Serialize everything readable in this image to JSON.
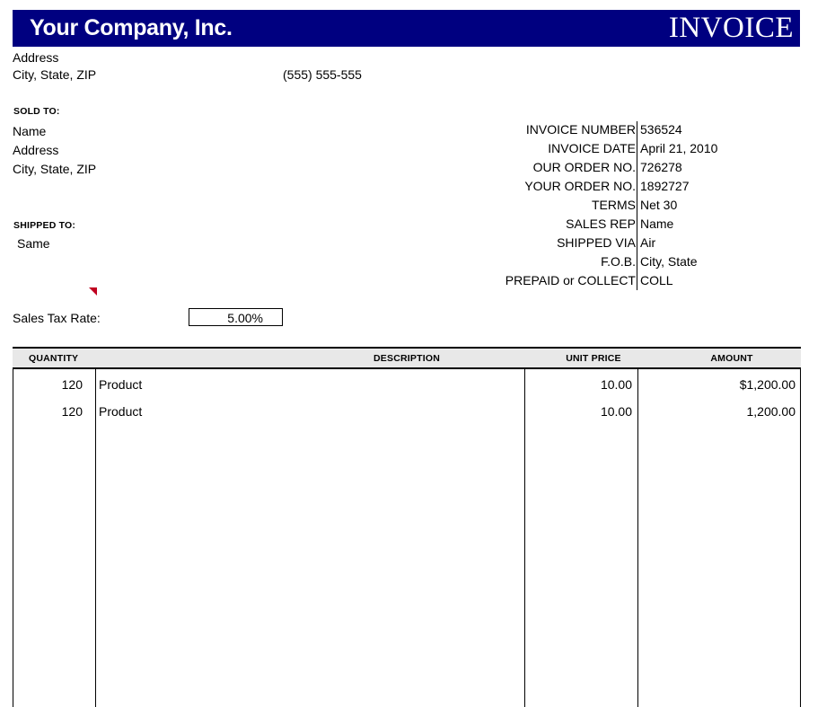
{
  "header": {
    "company_name": "Your Company, Inc.",
    "document_type": "INVOICE",
    "band_color": "#000080",
    "text_color": "#FFFFFF"
  },
  "company": {
    "address_line1": "Address",
    "address_line2": "City, State, ZIP",
    "phone": "(555) 555-555"
  },
  "sold_to": {
    "heading": "SOLD TO:",
    "line1": "Name",
    "line2": "Address",
    "line3": "City, State, ZIP"
  },
  "shipped_to": {
    "heading": "SHIPPED TO:",
    "line1": "Same"
  },
  "tax": {
    "label": "Sales Tax Rate:",
    "value": "5.00%"
  },
  "comment_marker": {
    "color": "#C00020"
  },
  "details": [
    {
      "label": "INVOICE NUMBER",
      "value": "536524"
    },
    {
      "label": "INVOICE DATE",
      "value": "April 21, 2010"
    },
    {
      "label": "OUR ORDER NO.",
      "value": "726278"
    },
    {
      "label": "YOUR ORDER NO.",
      "value": "1892727"
    },
    {
      "label": "TERMS",
      "value": "Net 30"
    },
    {
      "label": "SALES REP",
      "value": "Name"
    },
    {
      "label": "SHIPPED VIA",
      "value": "Air"
    },
    {
      "label": "F.O.B.",
      "value": "City, State"
    },
    {
      "label": "PREPAID or COLLECT",
      "value": "COLL"
    }
  ],
  "items_table": {
    "columns": [
      "QUANTITY",
      "DESCRIPTION",
      "UNIT PRICE",
      "AMOUNT"
    ],
    "header_background": "#E8E8E8",
    "rows": [
      {
        "quantity": "120",
        "description": "Product",
        "unit_price": "10.00",
        "amount": "$1,200.00"
      },
      {
        "quantity": "120",
        "description": "Product",
        "unit_price": "10.00",
        "amount": "1,200.00"
      }
    ]
  }
}
